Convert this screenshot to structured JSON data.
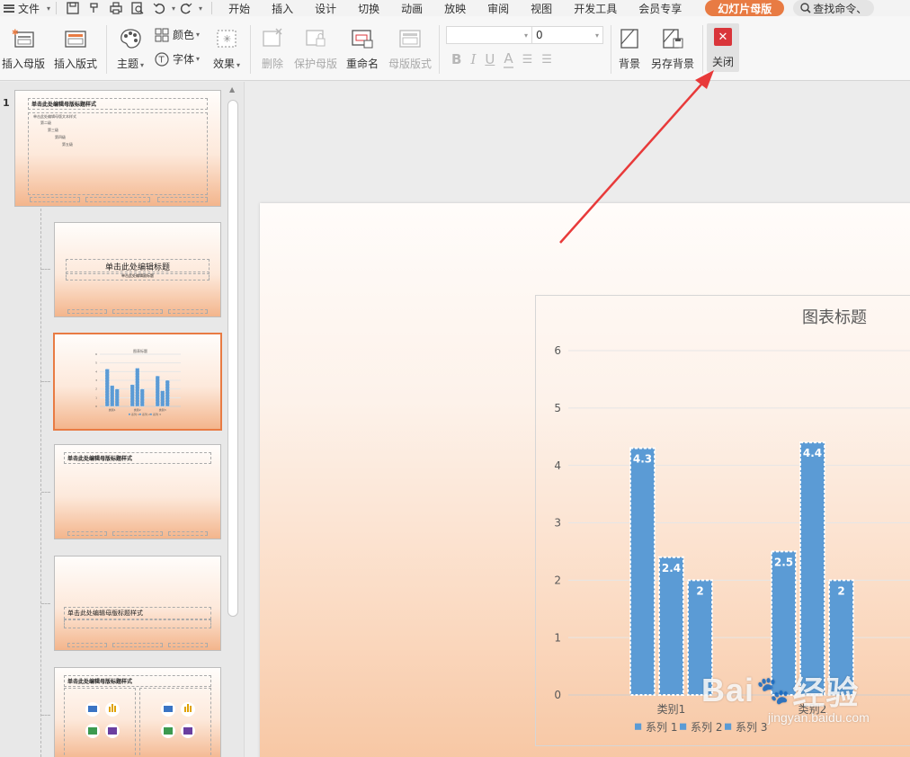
{
  "menubar": {
    "file_label": "文件",
    "tabs": [
      "开始",
      "插入",
      "设计",
      "切换",
      "动画",
      "放映",
      "审阅",
      "视图",
      "开发工具",
      "会员专享"
    ],
    "active_tab": "幻灯片母版",
    "search_placeholder": "查找命令、"
  },
  "ribbon": {
    "insert_master": "插入母版",
    "insert_layout": "插入版式",
    "theme": "主题",
    "color": "颜色",
    "font": "字体",
    "effect": "效果",
    "delete": "删除",
    "protect_master": "保护母版",
    "rename": "重命名",
    "master_layout": "母版版式",
    "font_size_value": "0",
    "background": "背景",
    "save_background": "另存背景",
    "close": "关闭"
  },
  "panel": {
    "slide_number": "1",
    "thumb1_title": "单击此处编辑母版标题样式",
    "thumb1_lines": [
      "单击此处编辑母版文本样式",
      "第二级",
      "第三级",
      "第四级",
      "第五级"
    ],
    "thumb2_title": "单击此处编辑标题",
    "thumb2_sub": "单击此处编辑副标题",
    "thumb4_title": "单击此处编辑母版标题样式",
    "thumb5_title": "单击此处编辑母版标题样式",
    "thumb6_title": "单击此处编辑母版标题样式"
  },
  "chart_data": {
    "type": "bar",
    "title": "图表标题",
    "categories": [
      "类别1",
      "类别2",
      "类别3"
    ],
    "series": [
      {
        "name": "系列 1",
        "values": [
          4.3,
          2.5,
          3.5
        ]
      },
      {
        "name": "系列 2",
        "values": [
          2.4,
          4.4,
          1.8
        ]
      },
      {
        "name": "系列 3",
        "values": [
          2,
          2,
          3
        ]
      }
    ],
    "ylim": [
      0,
      6
    ],
    "yticks": [
      0,
      1,
      2,
      3,
      4,
      5,
      6
    ],
    "grid": true,
    "legend": "bottom",
    "bar_color": "#5b9bd5"
  },
  "watermark": {
    "brand": "Bai",
    "brand2": "经验",
    "url": "jingyan.baidu.com"
  }
}
